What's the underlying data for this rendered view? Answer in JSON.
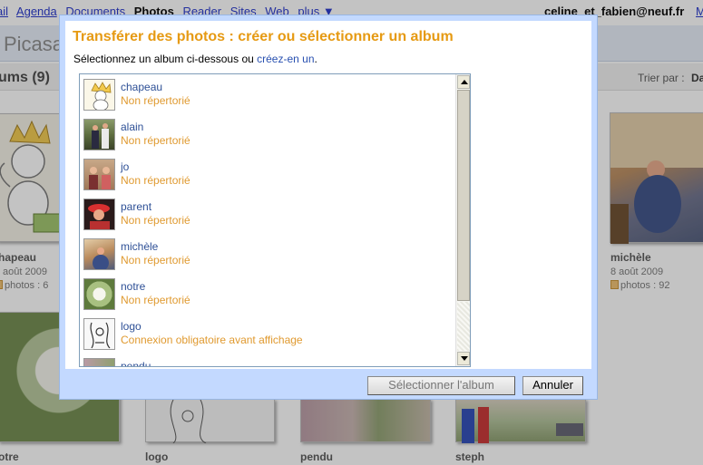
{
  "topnav": {
    "items": [
      {
        "label": "ail",
        "current": false
      },
      {
        "label": "Agenda",
        "current": false
      },
      {
        "label": "Documents",
        "current": false
      },
      {
        "label": "Photos",
        "current": true
      },
      {
        "label": "Reader",
        "current": false
      },
      {
        "label": "Sites",
        "current": false
      },
      {
        "label": "Web",
        "current": false
      },
      {
        "label": "plus ▼",
        "current": false
      }
    ],
    "email": "celine_et_fabien@neuf.fr",
    "extra": "M"
  },
  "header": {
    "brand": "Picasa"
  },
  "albums_bar": {
    "title": "ums (9)",
    "sort_label": "Trier par :",
    "sort_value": "Da"
  },
  "background_albums": [
    {
      "name": "hapeau",
      "date": "août 2009",
      "count": "photos : 6"
    },
    {
      "name": "michèle",
      "date": "8 août 2009",
      "count": "photos : 92"
    },
    {
      "name": "otre"
    },
    {
      "name": "logo"
    },
    {
      "name": "pendu"
    },
    {
      "name": "steph"
    }
  ],
  "dialog": {
    "title": "Transférer des photos : créer ou sélectionner un album",
    "instruction_prefix": "Sélectionnez un album ci-dessous ou ",
    "instruction_link": "créez-en un",
    "instruction_suffix": ".",
    "albums": [
      {
        "name": "chapeau",
        "status": "Non répertorié"
      },
      {
        "name": "alain",
        "status": "Non répertorié"
      },
      {
        "name": "jo",
        "status": "Non répertorié"
      },
      {
        "name": "parent",
        "status": "Non répertorié"
      },
      {
        "name": "michèle",
        "status": "Non répertorié"
      },
      {
        "name": "notre",
        "status": "Non répertorié"
      },
      {
        "name": "logo",
        "status": "Connexion obligatoire avant affichage"
      },
      {
        "name": "pendu",
        "status": ""
      }
    ],
    "select_button": "Sélectionner l'album",
    "cancel_button": "Annuler"
  },
  "colors": {
    "dialog_title": "#e69a13",
    "dialog_frame": "#c3d9ff",
    "album_name": "#2e5096",
    "album_status": "#e09a30",
    "link": "#2850b0"
  }
}
